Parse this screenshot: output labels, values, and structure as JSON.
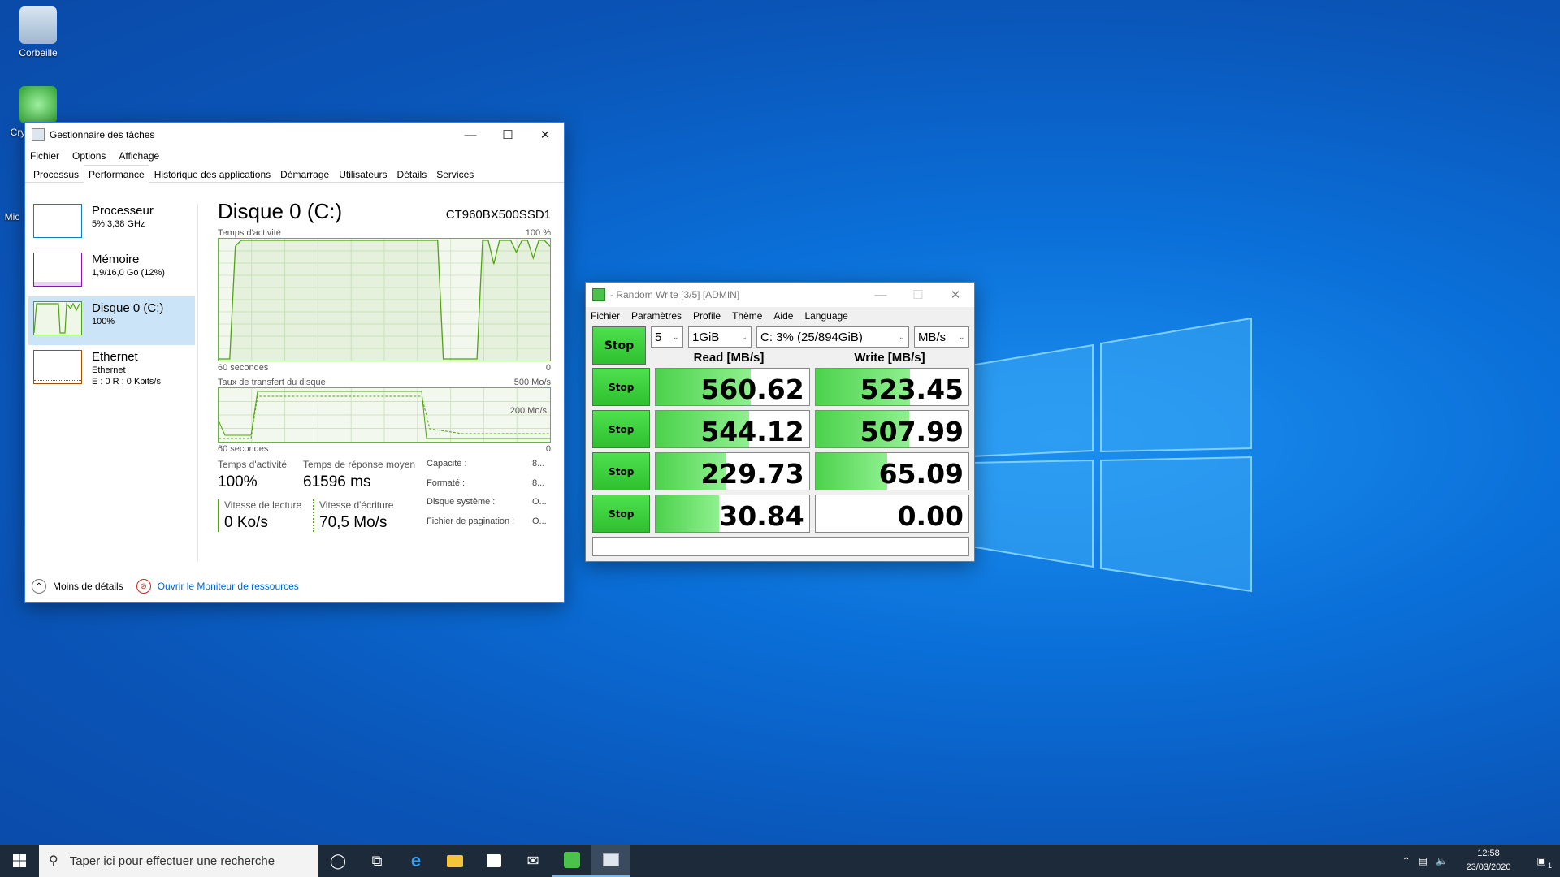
{
  "desktop": {
    "icons": [
      {
        "label": "Corbeille"
      },
      {
        "label": "Crys"
      },
      {
        "label": "Mic"
      }
    ]
  },
  "taskmgr": {
    "title": "Gestionnaire des tâches",
    "menu": [
      "Fichier",
      "Options",
      "Affichage"
    ],
    "tabs": [
      "Processus",
      "Performance",
      "Historique des applications",
      "Démarrage",
      "Utilisateurs",
      "Détails",
      "Services"
    ],
    "active_tab": "Performance",
    "resources": [
      {
        "name": "Processeur",
        "sub": "5% 3,38 GHz",
        "color": "#117dbb"
      },
      {
        "name": "Mémoire",
        "sub": "1,9/16,0 Go (12%)",
        "color": "#8b12ae"
      },
      {
        "name": "Disque 0 (C:)",
        "sub": "100%",
        "color": "#4da60c"
      },
      {
        "name": "Ethernet",
        "sub": "Ethernet",
        "sub2": "E : 0 R : 0 Kbits/s",
        "color": "#a74f01"
      }
    ],
    "disk": {
      "title": "Disque 0 (C:)",
      "model": "CT960BX500SSD1",
      "graph1_label": "Temps d'activité",
      "graph1_max": "100 %",
      "graph1_time": "60 secondes",
      "graph1_min": "0",
      "graph1_values": [
        0,
        0,
        0,
        95,
        100,
        100,
        100,
        100,
        100,
        100,
        100,
        100,
        100,
        100,
        100,
        100,
        100,
        100,
        100,
        100,
        100,
        100,
        100,
        100,
        100,
        100,
        100,
        100,
        100,
        100,
        100,
        100,
        100,
        100,
        100,
        100,
        100,
        100,
        100,
        100,
        0,
        0,
        0,
        0,
        0,
        0,
        0,
        100,
        100,
        80,
        100,
        100,
        100,
        90,
        100,
        100,
        85,
        100,
        100,
        95
      ],
      "graph2_label": "Taux de transfert du disque",
      "graph2_max": "500 Mo/s",
      "graph2_mid": "200 Mo/s",
      "graph2_time": "60 secondes",
      "graph2_min": "0",
      "stats": {
        "activity_label": "Temps d'activité",
        "activity_value": "100%",
        "response_label": "Temps de réponse moyen",
        "response_value": "61596 ms",
        "read_label": "Vitesse de lecture",
        "read_value": "0 Ko/s",
        "write_label": "Vitesse d'écriture",
        "write_value": "70,5 Mo/s"
      },
      "props": [
        {
          "k": "Capacité :",
          "v": "8..."
        },
        {
          "k": "Formaté :",
          "v": "8..."
        },
        {
          "k": "Disque système :",
          "v": "O..."
        },
        {
          "k": "Fichier de pagination :",
          "v": "O..."
        }
      ]
    },
    "footer": {
      "less": "Moins de détails",
      "monitor": "Ouvrir le Moniteur de ressources"
    }
  },
  "cdm": {
    "title": "- Random Write [3/5] [ADMIN]",
    "menu": [
      "Fichier",
      "Paramètres",
      "Profile",
      "Thème",
      "Aide",
      "Language"
    ],
    "count": "5",
    "size": "1GiB",
    "drive": "C: 3% (25/894GiB)",
    "unit": "MB/s",
    "stop_all": "Stop",
    "read_header": "Read [MB/s]",
    "write_header": "Write [MB/s]",
    "rows": [
      {
        "btn": "Stop",
        "read": "560.62",
        "read_pct": 0.62,
        "write": "523.45",
        "write_pct": 0.62
      },
      {
        "btn": "Stop",
        "read": "544.12",
        "read_pct": 0.61,
        "write": "507.99",
        "write_pct": 0.61
      },
      {
        "btn": "Stop",
        "read": "229.73",
        "read_pct": 0.46,
        "write": "65.09",
        "write_pct": 0.47
      },
      {
        "btn": "Stop",
        "read": "30.84",
        "read_pct": 0.41,
        "write": "0.00",
        "write_pct": 0
      }
    ]
  },
  "taskbar": {
    "search_placeholder": "Taper ici pour effectuer une recherche",
    "time": "12:58",
    "date": "23/03/2020",
    "notif_count": "1"
  }
}
